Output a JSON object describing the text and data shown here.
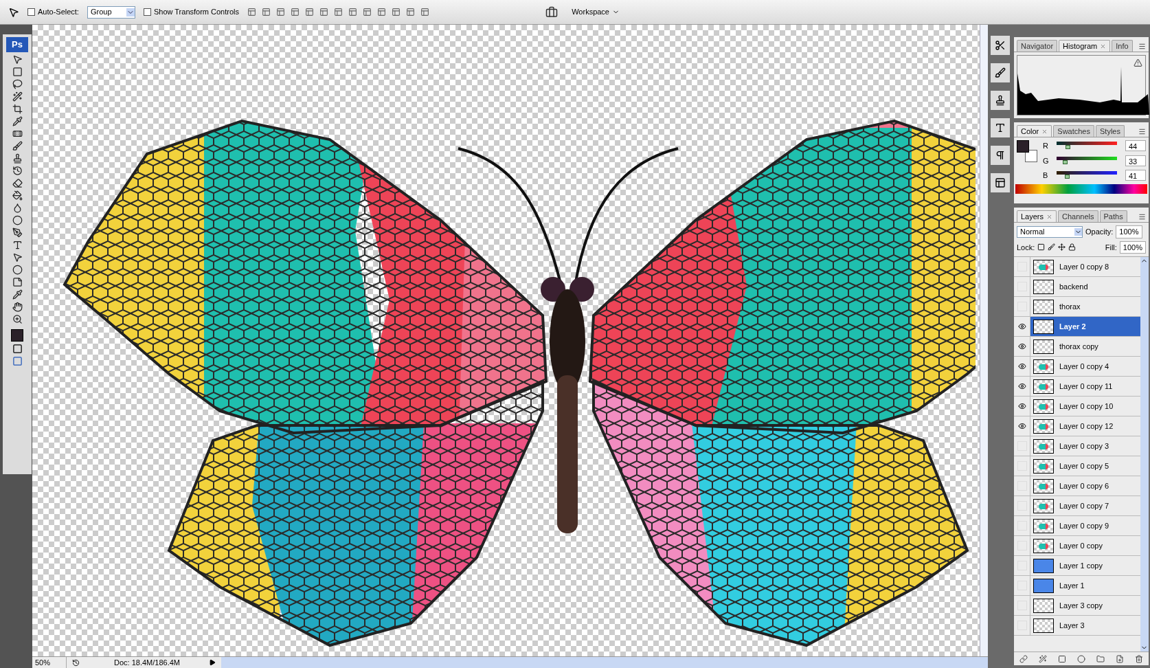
{
  "options_bar": {
    "auto_select": {
      "label": "Auto-Select:",
      "checked": false
    },
    "auto_select_mode": "Group",
    "transform_controls": {
      "label": "Show Transform Controls",
      "checked": false
    },
    "workspace": "Workspace"
  },
  "toolbox": {
    "logo": "Ps"
  },
  "histogram_panel": {
    "tabs": [
      {
        "label": "Navigator",
        "selected": false
      },
      {
        "label": "Histogram",
        "selected": true
      },
      {
        "label": "Info",
        "selected": false
      }
    ]
  },
  "color_panel": {
    "tabs": [
      {
        "label": "Color",
        "selected": true
      },
      {
        "label": "Swatches",
        "selected": false
      },
      {
        "label": "Styles",
        "selected": false
      }
    ],
    "channels": [
      {
        "name": "R",
        "level": 0.17,
        "reading": "44"
      },
      {
        "name": "G",
        "level": 0.13,
        "reading": "33"
      },
      {
        "name": "B",
        "level": 0.16,
        "reading": "41"
      }
    ]
  },
  "layers_panel": {
    "tabs": [
      {
        "label": "Layers",
        "selected": true
      },
      {
        "label": "Channels",
        "selected": false
      },
      {
        "label": "Paths",
        "selected": false
      }
    ],
    "blend_mode": "Normal",
    "opacity_label": "Opacity:",
    "opacity": "100%",
    "lock_label": "Lock:",
    "fill_label": "Fill:",
    "fill": "100%",
    "layers": [
      {
        "name": "Layer 0 copy 8",
        "visible": false,
        "selected": false,
        "kind": "art"
      },
      {
        "name": "backend",
        "visible": false,
        "selected": false,
        "kind": "empty"
      },
      {
        "name": "thorax",
        "visible": false,
        "selected": false,
        "kind": "empty"
      },
      {
        "name": "Layer 2",
        "visible": true,
        "selected": true,
        "kind": "empty"
      },
      {
        "name": "thorax copy",
        "visible": true,
        "selected": false,
        "kind": "empty"
      },
      {
        "name": "Layer 0 copy 4",
        "visible": true,
        "selected": false,
        "kind": "art"
      },
      {
        "name": "Layer 0 copy 11",
        "visible": true,
        "selected": false,
        "kind": "art"
      },
      {
        "name": "Layer 0 copy 10",
        "visible": true,
        "selected": false,
        "kind": "art"
      },
      {
        "name": "Layer 0 copy 12",
        "visible": true,
        "selected": false,
        "kind": "art"
      },
      {
        "name": "Layer 0 copy 3",
        "visible": false,
        "selected": false,
        "kind": "art"
      },
      {
        "name": "Layer 0 copy 5",
        "visible": false,
        "selected": false,
        "kind": "art"
      },
      {
        "name": "Layer 0 copy 6",
        "visible": false,
        "selected": false,
        "kind": "art"
      },
      {
        "name": "Layer 0 copy 7",
        "visible": false,
        "selected": false,
        "kind": "art"
      },
      {
        "name": "Layer 0 copy 9",
        "visible": false,
        "selected": false,
        "kind": "art"
      },
      {
        "name": "Layer 0 copy",
        "visible": false,
        "selected": false,
        "kind": "art"
      },
      {
        "name": "Layer 1 copy",
        "visible": false,
        "selected": false,
        "kind": "blue"
      },
      {
        "name": "Layer 1",
        "visible": false,
        "selected": false,
        "kind": "blue"
      },
      {
        "name": "Layer 3 copy",
        "visible": false,
        "selected": false,
        "kind": "empty"
      },
      {
        "name": "Layer 3",
        "visible": false,
        "selected": false,
        "kind": "empty"
      }
    ]
  },
  "status_bar": {
    "zoom": "50%",
    "doc": "Doc: 18.4M/186.4M"
  }
}
